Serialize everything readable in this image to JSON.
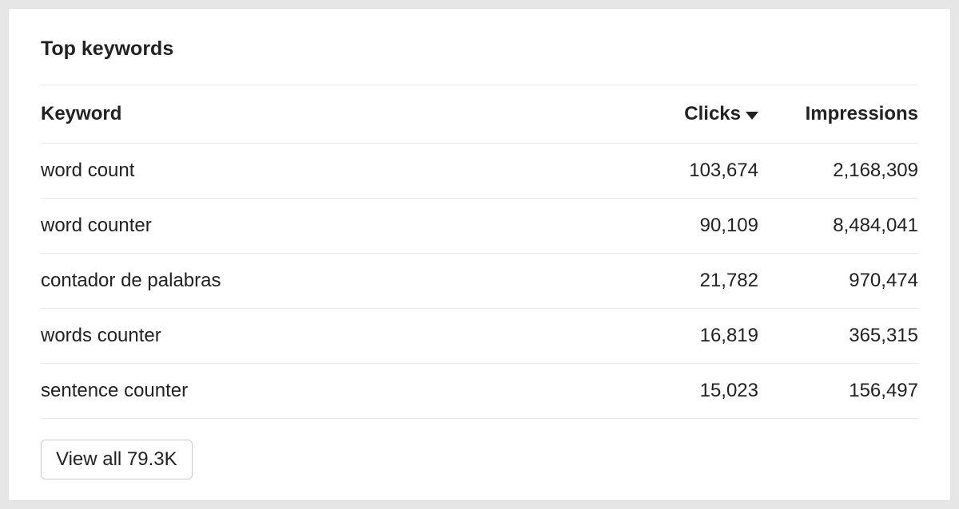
{
  "card": {
    "title": "Top keywords",
    "columns": {
      "keyword": "Keyword",
      "clicks": "Clicks",
      "impressions": "Impressions"
    },
    "rows": [
      {
        "keyword": "word count",
        "clicks": "103,674",
        "impressions": "2,168,309"
      },
      {
        "keyword": "word counter",
        "clicks": "90,109",
        "impressions": "8,484,041"
      },
      {
        "keyword": "contador de palabras",
        "clicks": "21,782",
        "impressions": "970,474"
      },
      {
        "keyword": "words counter",
        "clicks": "16,819",
        "impressions": "365,315"
      },
      {
        "keyword": "sentence counter",
        "clicks": "15,023",
        "impressions": "156,497"
      }
    ],
    "view_all_label": "View all 79.3K"
  }
}
